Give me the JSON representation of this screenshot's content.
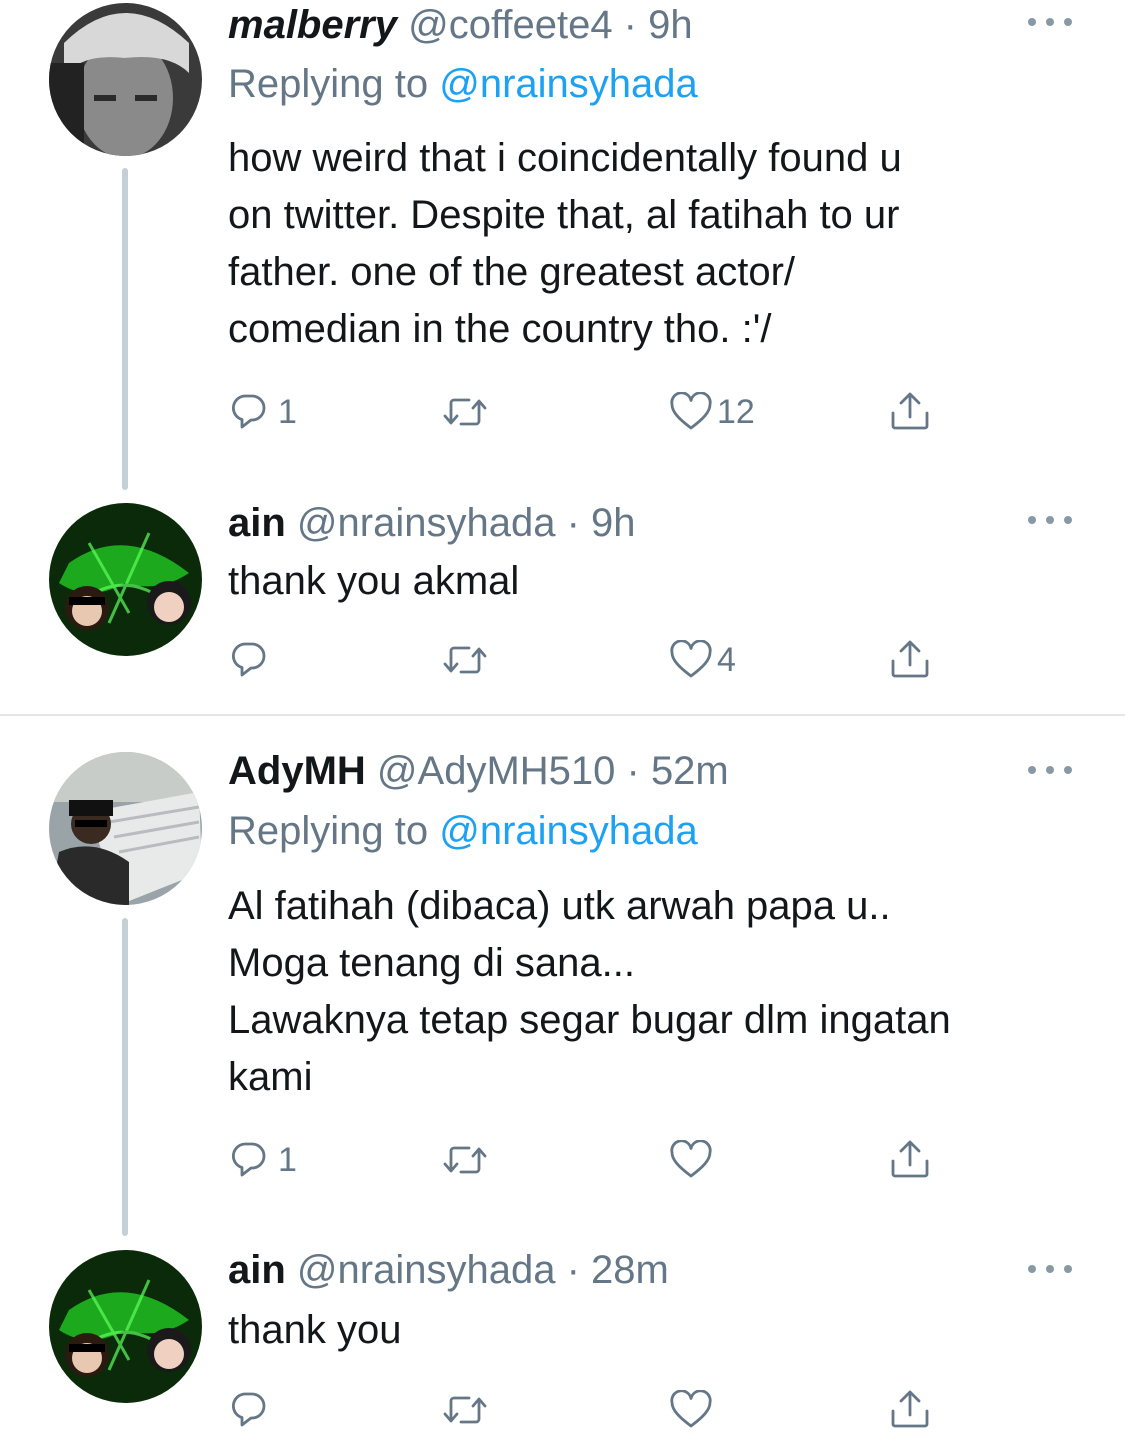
{
  "tweets": [
    {
      "name": "malberry",
      "handle": "@coffeete4",
      "time": "9h",
      "replying_label": "Replying to",
      "replying_to": "@nrainsyhada",
      "lines": [
        "how weird that i coincidentally found u",
        "on twitter. Despite that, al fatihah to ur",
        "father. one of the greatest actor/",
        "comedian in the country tho. :'/"
      ],
      "reply_count": "1",
      "like_count": "12"
    },
    {
      "name": "ain",
      "handle": "@nrainsyhada",
      "time": "9h",
      "lines": [
        "thank you akmal"
      ],
      "reply_count": "",
      "like_count": "4"
    },
    {
      "name": "AdyMH",
      "handle": "@AdyMH510",
      "time": "52m",
      "replying_label": "Replying to",
      "replying_to": "@nrainsyhada",
      "lines": [
        "Al fatihah (dibaca) utk arwah papa u..",
        "Moga tenang di sana...",
        "Lawaknya tetap segar bugar dlm ingatan",
        "kami"
      ],
      "reply_count": "1",
      "like_count": ""
    },
    {
      "name": "ain",
      "handle": "@nrainsyhada",
      "time": "28m",
      "lines": [
        "thank you"
      ],
      "reply_count": "",
      "like_count": ""
    }
  ],
  "separator": "·",
  "colors": {
    "accent": "#1da1f2",
    "muted": "#657786",
    "text": "#14171a",
    "thread_line": "#c4cfd6"
  }
}
